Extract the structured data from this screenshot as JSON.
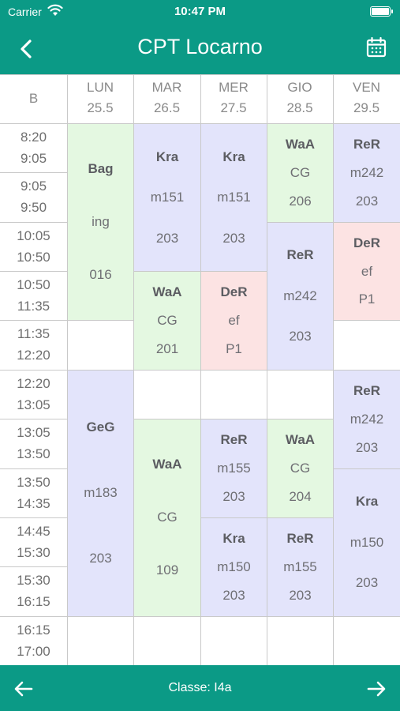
{
  "status_bar": {
    "carrier": "Carrier",
    "time": "10:47 PM"
  },
  "nav": {
    "title": "CPT Locarno",
    "back_icon": "chevron-left-icon",
    "calendar_icon": "calendar-icon"
  },
  "table": {
    "corner": "B",
    "days": [
      {
        "name": "LUN",
        "date": "25.5"
      },
      {
        "name": "MAR",
        "date": "26.5"
      },
      {
        "name": "MER",
        "date": "27.5"
      },
      {
        "name": "GIO",
        "date": "28.5"
      },
      {
        "name": "VEN",
        "date": "29.5"
      }
    ],
    "periods": [
      {
        "start": "8:20",
        "end": "9:05"
      },
      {
        "start": "9:05",
        "end": "9:50"
      },
      {
        "start": "10:05",
        "end": "10:50"
      },
      {
        "start": "10:50",
        "end": "11:35"
      },
      {
        "start": "11:35",
        "end": "12:20"
      },
      {
        "start": "12:20",
        "end": "13:05"
      },
      {
        "start": "13:05",
        "end": "13:50"
      },
      {
        "start": "13:50",
        "end": "14:35"
      },
      {
        "start": "14:45",
        "end": "15:30"
      },
      {
        "start": "15:30",
        "end": "16:15"
      },
      {
        "start": "16:15",
        "end": "17:00"
      }
    ],
    "lessons": [
      {
        "day": 0,
        "from": 0,
        "span": 4,
        "subject": "Bag",
        "code": "ing",
        "room": "016",
        "color": "green"
      },
      {
        "day": 0,
        "from": 5,
        "span": 5,
        "subject": "GeG",
        "code": "m183",
        "room": "203",
        "color": "purple"
      },
      {
        "day": 1,
        "from": 0,
        "span": 3,
        "subject": "Kra",
        "code": "m151",
        "room": "203",
        "color": "purple"
      },
      {
        "day": 1,
        "from": 3,
        "span": 2,
        "subject": "WaA",
        "code": "CG",
        "room": "201",
        "color": "green"
      },
      {
        "day": 1,
        "from": 6,
        "span": 4,
        "subject": "WaA",
        "code": "CG",
        "room": "109",
        "color": "green"
      },
      {
        "day": 2,
        "from": 0,
        "span": 3,
        "subject": "Kra",
        "code": "m151",
        "room": "203",
        "color": "purple"
      },
      {
        "day": 2,
        "from": 3,
        "span": 2,
        "subject": "DeR",
        "code": "ef",
        "room": "P1",
        "color": "pink"
      },
      {
        "day": 2,
        "from": 6,
        "span": 2,
        "subject": "ReR",
        "code": "m155",
        "room": "203",
        "color": "purple"
      },
      {
        "day": 2,
        "from": 8,
        "span": 2,
        "subject": "Kra",
        "code": "m150",
        "room": "203",
        "color": "purple"
      },
      {
        "day": 3,
        "from": 0,
        "span": 2,
        "subject": "WaA",
        "code": "CG",
        "room": "206",
        "color": "green"
      },
      {
        "day": 3,
        "from": 2,
        "span": 3,
        "subject": "ReR",
        "code": "m242",
        "room": "203",
        "color": "purple"
      },
      {
        "day": 3,
        "from": 6,
        "span": 2,
        "subject": "WaA",
        "code": "CG",
        "room": "204",
        "color": "green"
      },
      {
        "day": 3,
        "from": 8,
        "span": 2,
        "subject": "ReR",
        "code": "m155",
        "room": "203",
        "color": "purple"
      },
      {
        "day": 4,
        "from": 0,
        "span": 2,
        "subject": "ReR",
        "code": "m242",
        "room": "203",
        "color": "purple"
      },
      {
        "day": 4,
        "from": 2,
        "span": 2,
        "subject": "DeR",
        "code": "ef",
        "room": "P1",
        "color": "pink"
      },
      {
        "day": 4,
        "from": 5,
        "span": 2,
        "subject": "ReR",
        "code": "m242",
        "room": "203",
        "color": "purple"
      },
      {
        "day": 4,
        "from": 7,
        "span": 3,
        "subject": "Kra",
        "code": "m150",
        "room": "203",
        "color": "purple"
      }
    ]
  },
  "bottom_bar": {
    "classe": "Classe: I4a",
    "prev_icon": "arrow-left-icon",
    "next_icon": "arrow-right-icon"
  },
  "colors": {
    "brand": "#0b9a86",
    "purple": "#e3e4fb",
    "green": "#e4f8e1",
    "pink": "#fce3e3"
  }
}
